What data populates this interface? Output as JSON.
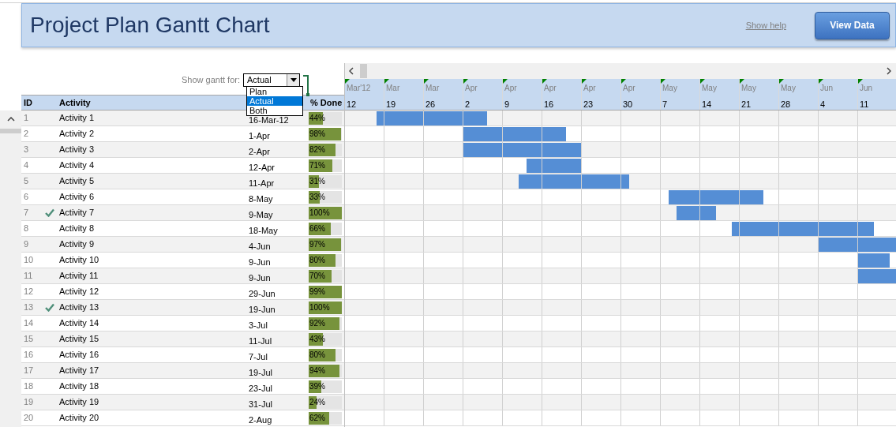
{
  "banner": {
    "title": "Project Plan Gantt Chart",
    "help_link": "Show help",
    "button": "View Data"
  },
  "gantt_filter": {
    "label": "Show gantt for:",
    "value": "Actual",
    "expanded": true,
    "options": [
      {
        "label": "Plan",
        "selected": false
      },
      {
        "label": "Actual",
        "selected": true
      },
      {
        "label": "Both",
        "selected": false
      }
    ]
  },
  "table": {
    "columns": [
      "ID",
      "Activity",
      "% Done"
    ],
    "rows": [
      {
        "id": "1",
        "activity": "Activity 1",
        "done": false,
        "date": "16-Mar-12",
        "percent": "44%",
        "level": 0.44
      },
      {
        "id": "2",
        "activity": "Activity 2",
        "done": false,
        "date": "1-Apr",
        "percent": "98%",
        "level": 0.98
      },
      {
        "id": "3",
        "activity": "Activity 3",
        "done": false,
        "date": "2-Apr",
        "percent": "82%",
        "level": 0.82
      },
      {
        "id": "4",
        "activity": "Activity 4",
        "done": false,
        "date": "12-Apr",
        "percent": "71%",
        "level": 0.71
      },
      {
        "id": "5",
        "activity": "Activity 5",
        "done": false,
        "date": "11-Apr",
        "percent": "31%",
        "level": 0.31
      },
      {
        "id": "6",
        "activity": "Activity 6",
        "done": false,
        "date": "8-May",
        "percent": "33%",
        "level": 0.33
      },
      {
        "id": "7",
        "activity": "Activity 7",
        "done": true,
        "date": "9-May",
        "percent": "100%",
        "level": 1
      },
      {
        "id": "8",
        "activity": "Activity 8",
        "done": false,
        "date": "18-May",
        "percent": "66%",
        "level": 0.66
      },
      {
        "id": "9",
        "activity": "Activity 9",
        "done": false,
        "date": "4-Jun",
        "percent": "97%",
        "level": 0.97
      },
      {
        "id": "10",
        "activity": "Activity 10",
        "done": false,
        "date": "9-Jun",
        "percent": "80%",
        "level": 0.8
      },
      {
        "id": "11",
        "activity": "Activity 11",
        "done": false,
        "date": "9-Jun",
        "percent": "70%",
        "level": 0.7
      },
      {
        "id": "12",
        "activity": "Activity 12",
        "done": false,
        "date": "29-Jun",
        "percent": "99%",
        "level": 0.99
      },
      {
        "id": "13",
        "activity": "Activity 13",
        "done": true,
        "date": "19-Jun",
        "percent": "100%",
        "level": 1
      },
      {
        "id": "14",
        "activity": "Activity 14",
        "done": false,
        "date": "3-Jul",
        "percent": "92%",
        "level": 0.92
      },
      {
        "id": "15",
        "activity": "Activity 15",
        "done": false,
        "date": "11-Jul",
        "percent": "43%",
        "level": 0.43
      },
      {
        "id": "16",
        "activity": "Activity 16",
        "done": false,
        "date": "7-Jul",
        "percent": "80%",
        "level": 0.8
      },
      {
        "id": "17",
        "activity": "Activity 17",
        "done": false,
        "date": "19-Jul",
        "percent": "94%",
        "level": 0.94
      },
      {
        "id": "18",
        "activity": "Activity 18",
        "done": false,
        "date": "23-Jul",
        "percent": "39%",
        "level": 0.39
      },
      {
        "id": "19",
        "activity": "Activity 19",
        "done": false,
        "date": "31-Jul",
        "percent": "24%",
        "level": 0.24
      },
      {
        "id": "20",
        "activity": "Activity 20",
        "done": false,
        "date": "2-Aug",
        "percent": "62%",
        "level": 0.62
      }
    ]
  },
  "gantt": {
    "weeks": [
      {
        "month": "Mar'12",
        "day": "12"
      },
      {
        "month": "Mar",
        "day": "19"
      },
      {
        "month": "Mar",
        "day": "26"
      },
      {
        "month": "Apr",
        "day": "2"
      },
      {
        "month": "Apr",
        "day": "9"
      },
      {
        "month": "Apr",
        "day": "16"
      },
      {
        "month": "Apr",
        "day": "23"
      },
      {
        "month": "Apr",
        "day": "30"
      },
      {
        "month": "May",
        "day": "7"
      },
      {
        "month": "May",
        "day": "14"
      },
      {
        "month": "May",
        "day": "21"
      },
      {
        "month": "May",
        "day": "28"
      },
      {
        "month": "Jun",
        "day": "4"
      },
      {
        "month": "Jun",
        "day": "11"
      }
    ]
  }
}
